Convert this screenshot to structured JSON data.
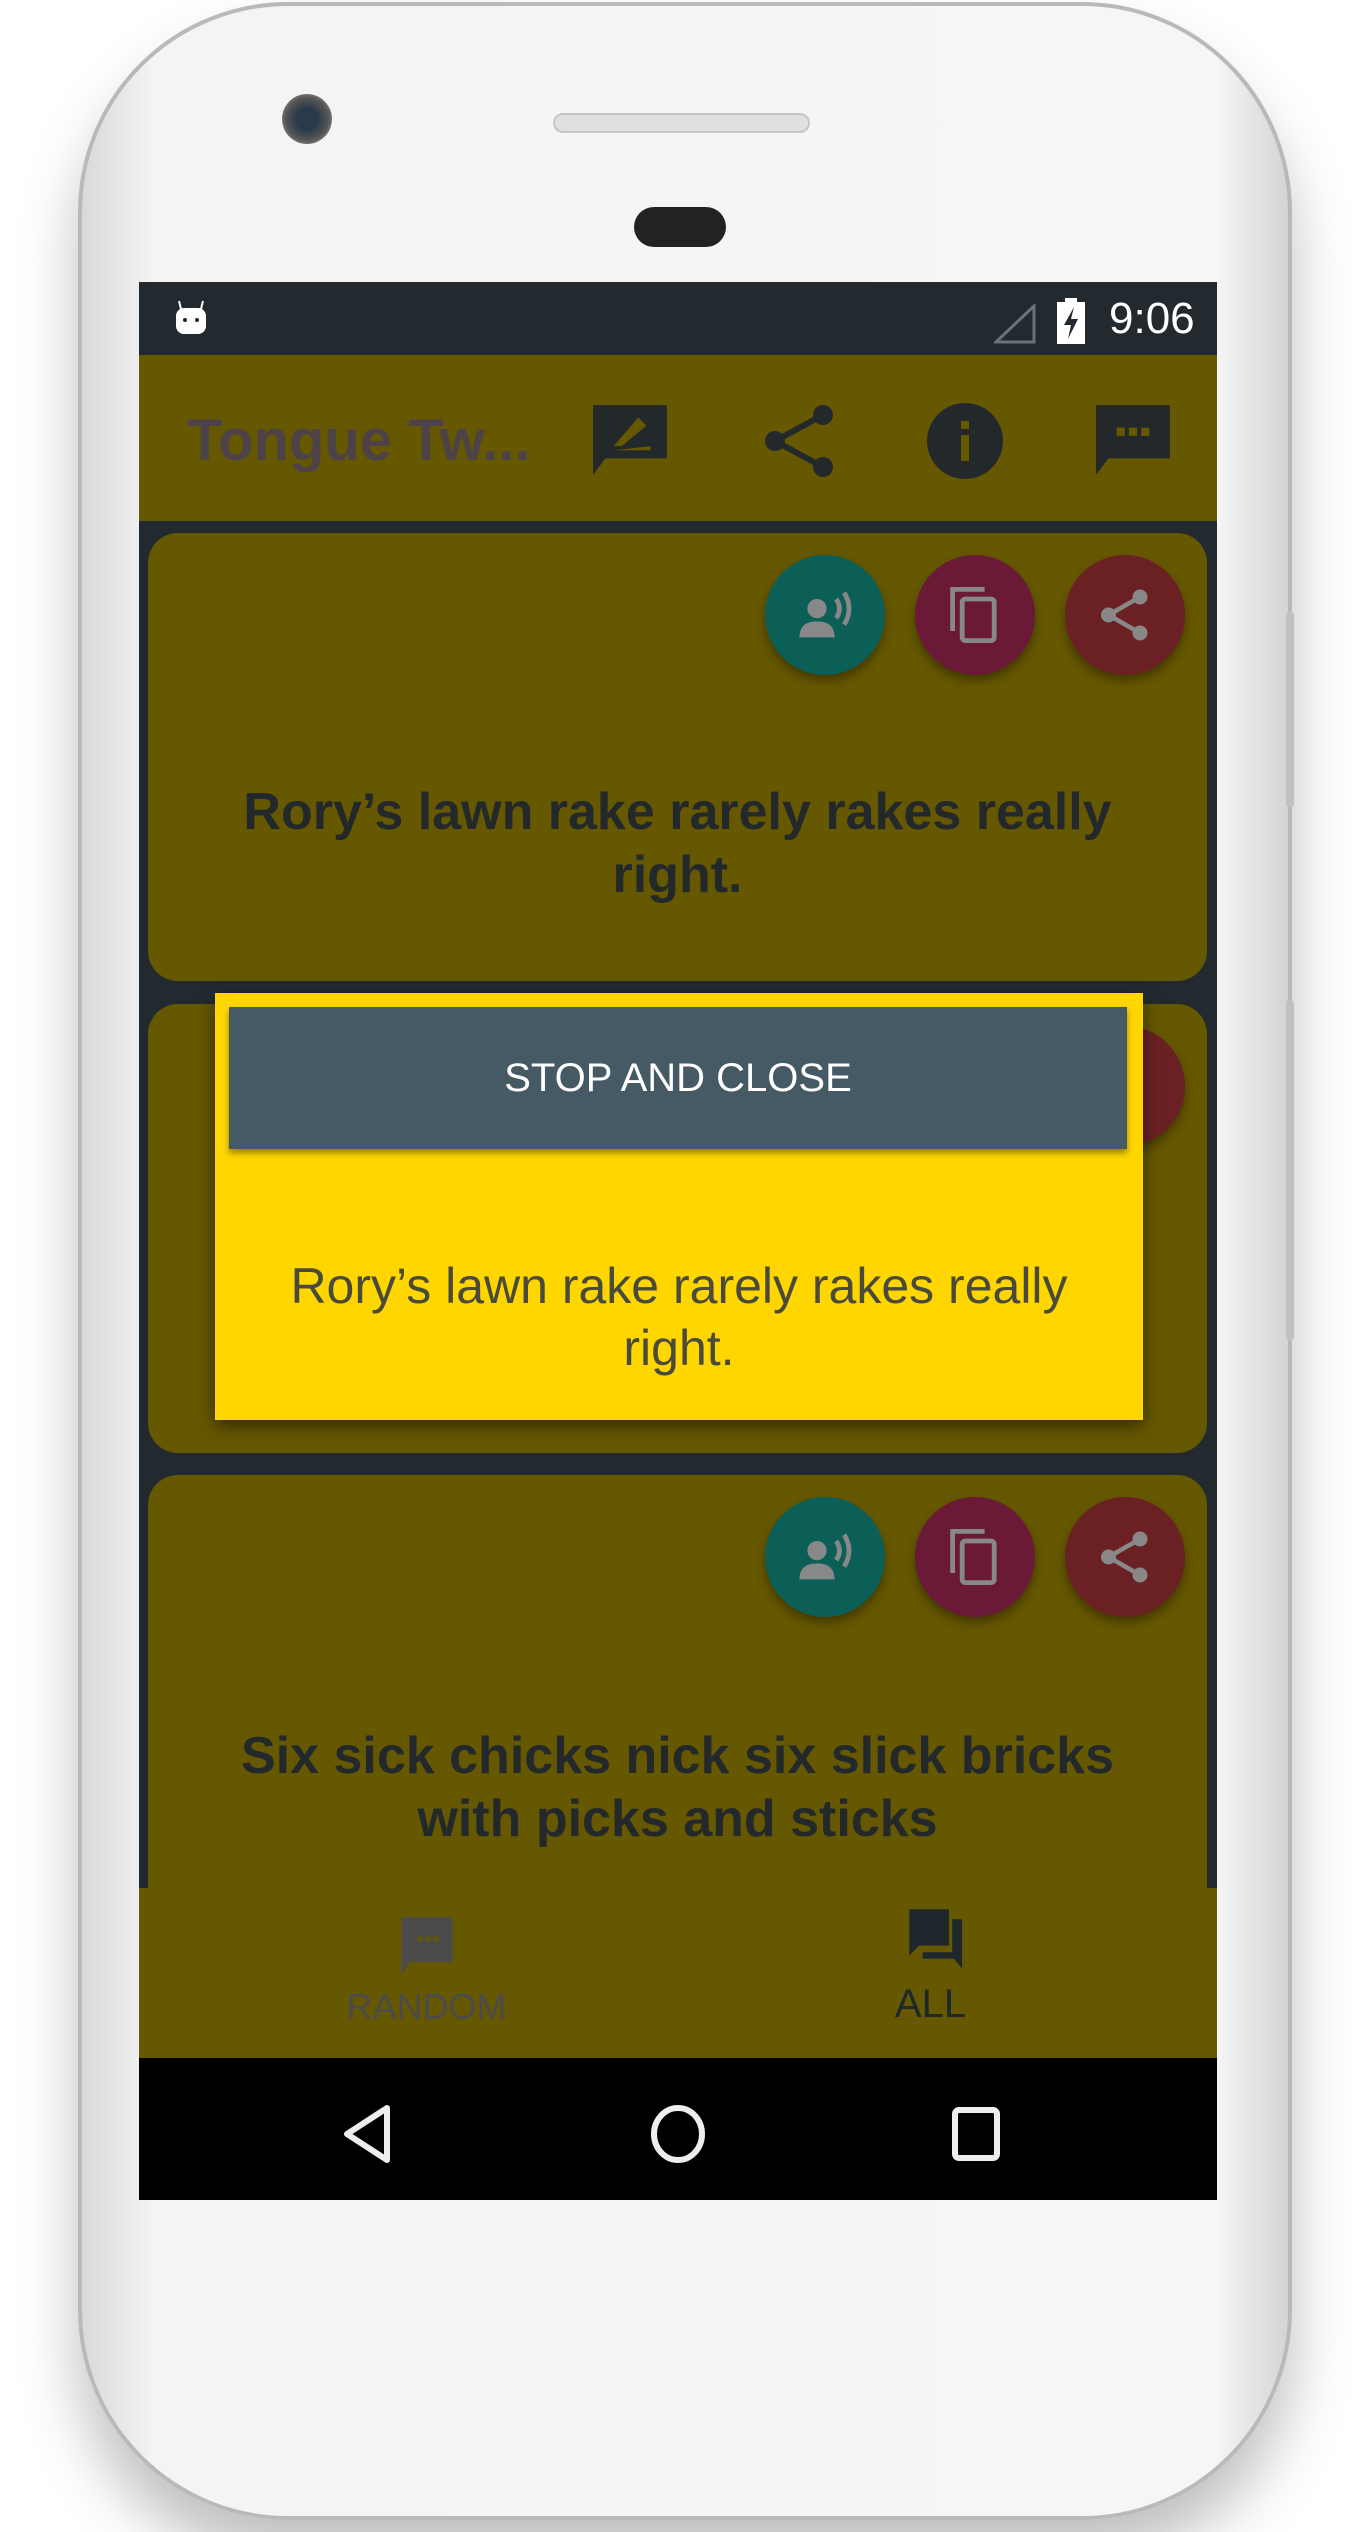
{
  "status_bar": {
    "time": "9:06"
  },
  "app_bar": {
    "title": "Tongue Tw...",
    "icons": [
      "edit-icon",
      "share-icon",
      "info-icon",
      "message-icon"
    ]
  },
  "cards": [
    {
      "text": "Rory’s lawn rake rarely rakes really right."
    },
    {
      "text": ""
    },
    {
      "text": "Six sick chicks nick six slick bricks with picks and sticks"
    }
  ],
  "dialog": {
    "button_label": "STOP AND CLOSE",
    "text": "Rory’s lawn rake rarely rakes really right."
  },
  "bottom_nav": {
    "items": [
      {
        "label": "RANDOM",
        "active": false
      },
      {
        "label": "ALL",
        "active": true
      }
    ]
  },
  "colors": {
    "dialog": "#FFD600",
    "button": "#455A64",
    "speak": "#009688",
    "copy": "#D81B60",
    "share": "#D32F2F"
  }
}
